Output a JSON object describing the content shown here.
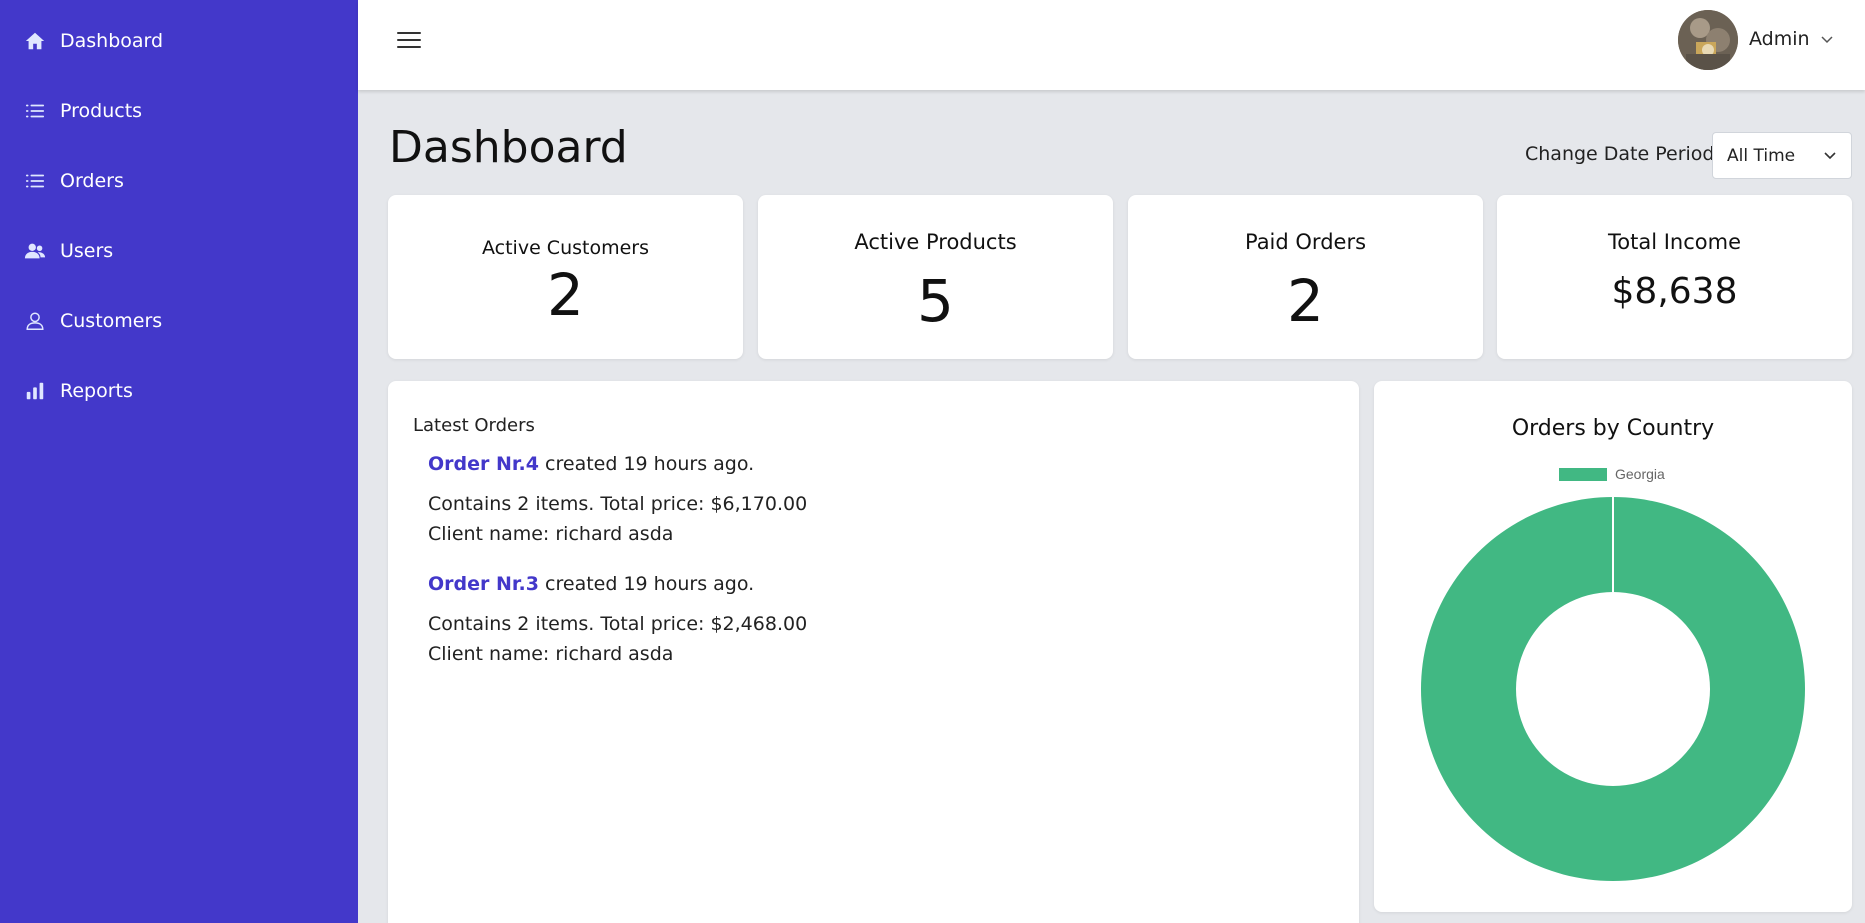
{
  "sidebar": {
    "items": [
      {
        "label": "Dashboard",
        "icon": "home-icon"
      },
      {
        "label": "Products",
        "icon": "list-icon"
      },
      {
        "label": "Orders",
        "icon": "list-icon"
      },
      {
        "label": "Users",
        "icon": "users-icon"
      },
      {
        "label": "Customers",
        "icon": "user-icon"
      },
      {
        "label": "Reports",
        "icon": "bar-chart-icon"
      }
    ],
    "bg_color": "#4338ca"
  },
  "header": {
    "user_name": "Admin",
    "menu_icon": "hamburger-icon"
  },
  "page": {
    "title": "Dashboard",
    "period_label": "Change Date Period",
    "period_value": "All Time"
  },
  "stats": [
    {
      "label": "Active Customers",
      "value": "2"
    },
    {
      "label": "Active Products",
      "value": "5"
    },
    {
      "label": "Paid Orders",
      "value": "2"
    },
    {
      "label": "Total Income",
      "value": "$8,638"
    }
  ],
  "latest_orders": {
    "title": "Latest Orders",
    "orders": [
      {
        "link": "Order Nr.4",
        "created": "created 19 hours ago.",
        "summary": "Contains 2 items. Total price: $6,170.00",
        "client": "Client name: richard asda"
      },
      {
        "link": "Order Nr.3",
        "created": "created 19 hours ago.",
        "summary": "Contains 2 items. Total price: $2,468.00",
        "client": "Client name: richard asda"
      }
    ]
  },
  "chart_data": {
    "type": "pie",
    "title": "Orders by Country",
    "categories": [
      "Georgia"
    ],
    "values": [
      2
    ],
    "colors": [
      "#41b883"
    ],
    "legend": "top",
    "donut": true
  },
  "colors": {
    "accent": "#4338ca",
    "page_bg": "#e5e7eb",
    "chart_green": "#41b883"
  }
}
